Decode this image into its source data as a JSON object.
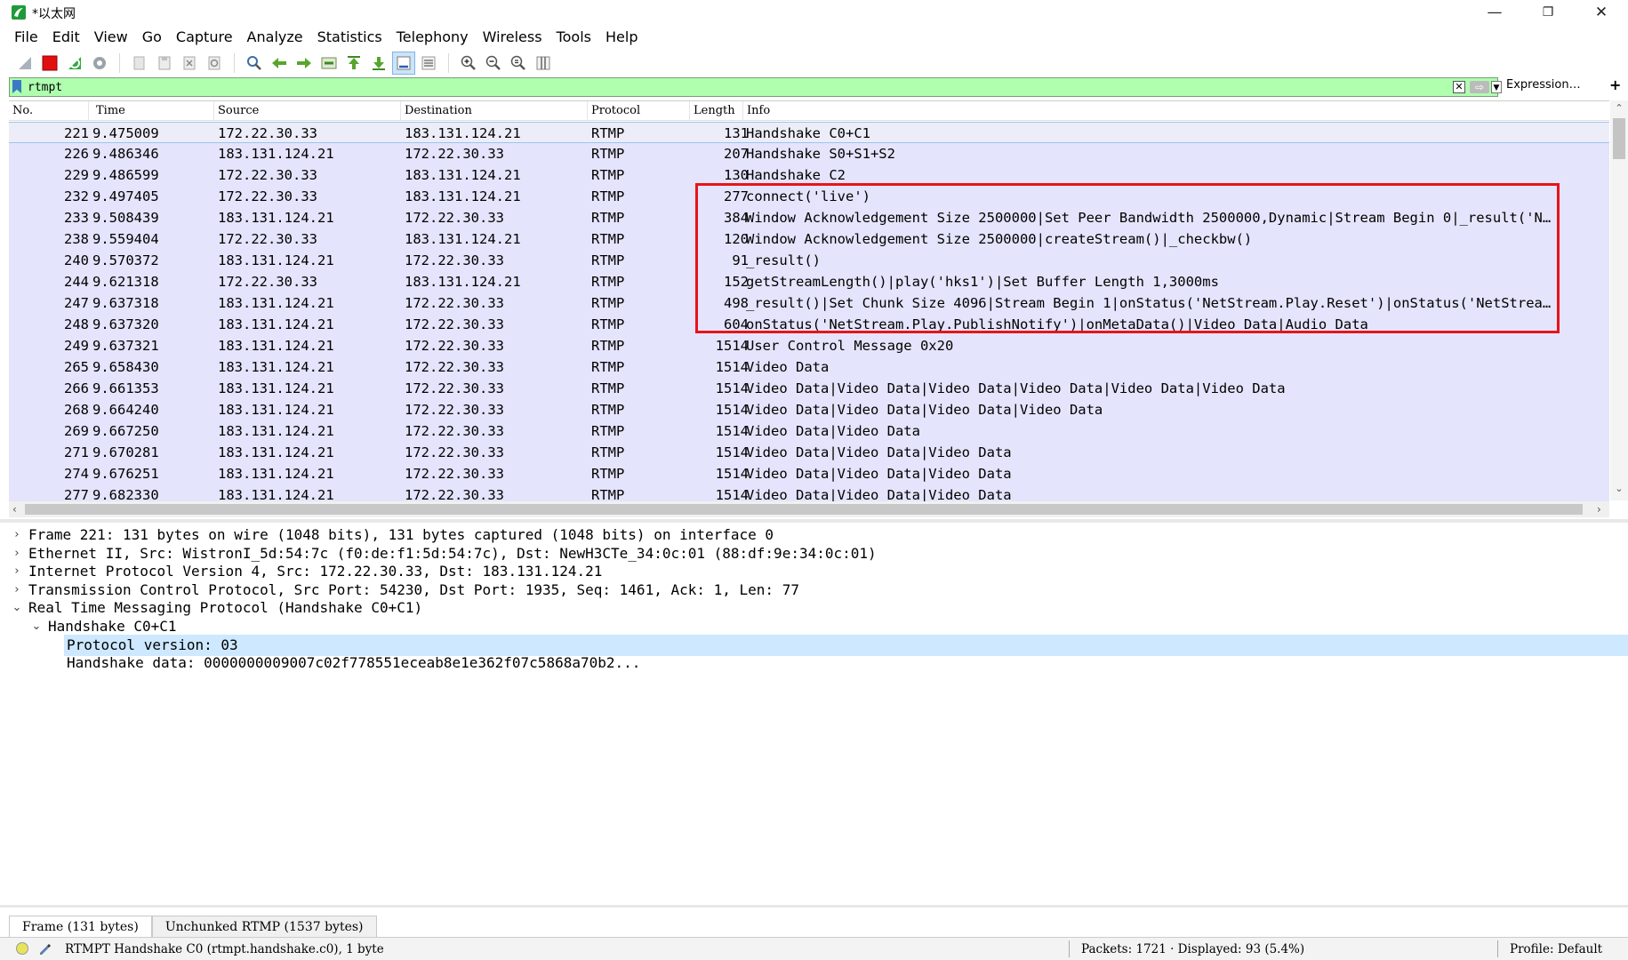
{
  "window": {
    "title": "*以太网",
    "minimize": "—",
    "restore": "❐",
    "close": "✕"
  },
  "menu": [
    "File",
    "Edit",
    "View",
    "Go",
    "Capture",
    "Analyze",
    "Statistics",
    "Telephony",
    "Wireless",
    "Tools",
    "Help"
  ],
  "filter": {
    "value": "rtmpt",
    "expression_label": "Expression…",
    "plus_label": "+"
  },
  "columns": {
    "no": "No.",
    "time": "Time",
    "source": "Source",
    "destination": "Destination",
    "protocol": "Protocol",
    "length": "Length",
    "info": "Info"
  },
  "packets": [
    {
      "no": "221",
      "time": "9.475009",
      "src": "172.22.30.33",
      "dst": "183.131.124.21",
      "proto": "RTMP",
      "len": "131",
      "info": "Handshake C0+C1"
    },
    {
      "no": "226",
      "time": "9.486346",
      "src": "183.131.124.21",
      "dst": "172.22.30.33",
      "proto": "RTMP",
      "len": "207",
      "info": "Handshake S0+S1+S2"
    },
    {
      "no": "229",
      "time": "9.486599",
      "src": "172.22.30.33",
      "dst": "183.131.124.21",
      "proto": "RTMP",
      "len": "130",
      "info": "Handshake C2"
    },
    {
      "no": "232",
      "time": "9.497405",
      "src": "172.22.30.33",
      "dst": "183.131.124.21",
      "proto": "RTMP",
      "len": "277",
      "info": "connect('live')"
    },
    {
      "no": "233",
      "time": "9.508439",
      "src": "183.131.124.21",
      "dst": "172.22.30.33",
      "proto": "RTMP",
      "len": "384",
      "info": "Window Acknowledgement Size 2500000|Set Peer Bandwidth 2500000,Dynamic|Stream Begin 0|_result('N…"
    },
    {
      "no": "238",
      "time": "9.559404",
      "src": "172.22.30.33",
      "dst": "183.131.124.21",
      "proto": "RTMP",
      "len": "120",
      "info": "Window Acknowledgement Size 2500000|createStream()|_checkbw()"
    },
    {
      "no": "240",
      "time": "9.570372",
      "src": "183.131.124.21",
      "dst": "172.22.30.33",
      "proto": "RTMP",
      "len": "91",
      "info": "_result()"
    },
    {
      "no": "244",
      "time": "9.621318",
      "src": "172.22.30.33",
      "dst": "183.131.124.21",
      "proto": "RTMP",
      "len": "152",
      "info": "getStreamLength()|play('hks1')|Set Buffer Length 1,3000ms"
    },
    {
      "no": "247",
      "time": "9.637318",
      "src": "183.131.124.21",
      "dst": "172.22.30.33",
      "proto": "RTMP",
      "len": "498",
      "info": "_result()|Set Chunk Size 4096|Stream Begin 1|onStatus('NetStream.Play.Reset')|onStatus('NetStrea…"
    },
    {
      "no": "248",
      "time": "9.637320",
      "src": "183.131.124.21",
      "dst": "172.22.30.33",
      "proto": "RTMP",
      "len": "604",
      "info": "onStatus('NetStream.Play.PublishNotify')|onMetaData()|Video Data|Audio Data"
    },
    {
      "no": "249",
      "time": "9.637321",
      "src": "183.131.124.21",
      "dst": "172.22.30.33",
      "proto": "RTMP",
      "len": "1514",
      "info": "User Control Message 0x20"
    },
    {
      "no": "265",
      "time": "9.658430",
      "src": "183.131.124.21",
      "dst": "172.22.30.33",
      "proto": "RTMP",
      "len": "1514",
      "info": "Video Data"
    },
    {
      "no": "266",
      "time": "9.661353",
      "src": "183.131.124.21",
      "dst": "172.22.30.33",
      "proto": "RTMP",
      "len": "1514",
      "info": "Video Data|Video Data|Video Data|Video Data|Video Data|Video Data"
    },
    {
      "no": "268",
      "time": "9.664240",
      "src": "183.131.124.21",
      "dst": "172.22.30.33",
      "proto": "RTMP",
      "len": "1514",
      "info": "Video Data|Video Data|Video Data|Video Data"
    },
    {
      "no": "269",
      "time": "9.667250",
      "src": "183.131.124.21",
      "dst": "172.22.30.33",
      "proto": "RTMP",
      "len": "1514",
      "info": "Video Data|Video Data"
    },
    {
      "no": "271",
      "time": "9.670281",
      "src": "183.131.124.21",
      "dst": "172.22.30.33",
      "proto": "RTMP",
      "len": "1514",
      "info": "Video Data|Video Data|Video Data"
    },
    {
      "no": "274",
      "time": "9.676251",
      "src": "183.131.124.21",
      "dst": "172.22.30.33",
      "proto": "RTMP",
      "len": "1514",
      "info": "Video Data|Video Data|Video Data"
    },
    {
      "no": "277",
      "time": "9.682330",
      "src": "183.131.124.21",
      "dst": "172.22.30.33",
      "proto": "RTMP",
      "len": "1514",
      "info": "Video Data|Video Data|Video Data"
    }
  ],
  "details": [
    {
      "text": "Frame 221: 131 bytes on wire (1048 bits), 131 bytes captured (1048 bits) on interface 0",
      "arrow": "›"
    },
    {
      "text": "Ethernet II, Src: WistronI_5d:54:7c (f0:de:f1:5d:54:7c), Dst: NewH3CTe_34:0c:01 (88:df:9e:34:0c:01)",
      "arrow": "›"
    },
    {
      "text": "Internet Protocol Version 4, Src: 172.22.30.33, Dst: 183.131.124.21",
      "arrow": "›"
    },
    {
      "text": "Transmission Control Protocol, Src Port: 54230, Dst Port: 1935, Seq: 1461, Ack: 1, Len: 77",
      "arrow": "›"
    },
    {
      "text": "Real Time Messaging Protocol (Handshake C0+C1)",
      "arrow": "⌄"
    },
    {
      "text": "Handshake C0+C1",
      "arrow": "⌄"
    },
    {
      "text": "Protocol version: 03",
      "arrow": ""
    },
    {
      "text": "Handshake data: 0000000009007c02f778551eceab8e1e362f07c5868a70b2...",
      "arrow": ""
    }
  ],
  "bytes_tabs": [
    "Frame (131 bytes)",
    "Unchunked RTMP (1537 bytes)"
  ],
  "status": {
    "field_text": "RTMPT Handshake C0 (rtmpt.handshake.c0), 1 byte",
    "packets_text": "Packets: 1721 · Displayed: 93 (5.4%)",
    "profile_text": "Profile: Default"
  },
  "colors": {
    "row_background": "#e4e4fc",
    "filter_valid": "#afffaf",
    "highlight_box": "#e8131b",
    "detail_selection": "#cde8ff"
  }
}
